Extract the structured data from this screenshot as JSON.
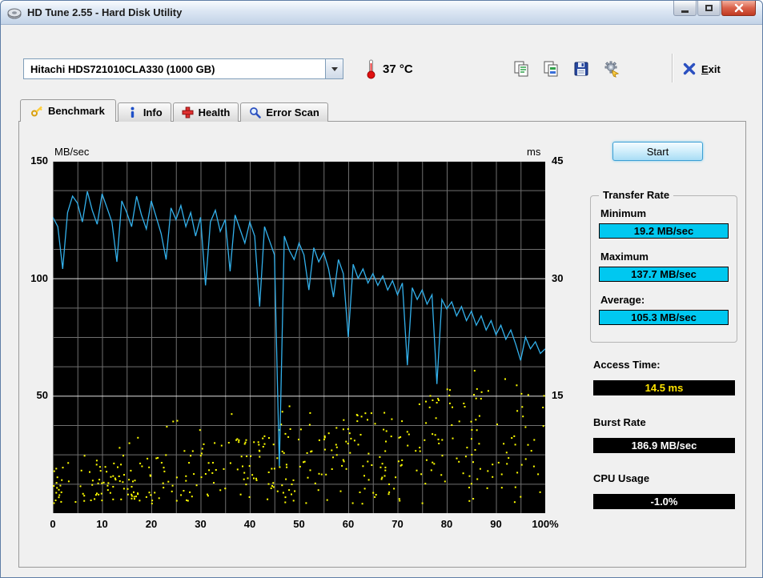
{
  "window": {
    "title": "HD Tune 2.55 - Hard Disk Utility"
  },
  "toolbar": {
    "device_select": {
      "value": "Hitachi HDS721010CLA330 (1000 GB)"
    },
    "temperature": "37 °C",
    "buttons": [
      {
        "label": "",
        "icon": "copy-screenshot-icon"
      },
      {
        "label": "",
        "icon": "copy-to-file-icon"
      },
      {
        "label": "",
        "icon": "save-icon"
      },
      {
        "label": "",
        "icon": "options-icon"
      }
    ],
    "exit": {
      "accesskey": "E",
      "rest": "xit"
    }
  },
  "tabs": [
    {
      "label": "Benchmark",
      "active": true
    },
    {
      "label": "Info",
      "active": false
    },
    {
      "label": "Health",
      "active": false
    },
    {
      "label": "Error Scan",
      "active": false
    }
  ],
  "chart_data": {
    "type": "line",
    "title": "HD Tune benchmark transfer rate and access time",
    "y_left_label": "MB/sec",
    "y_right_label": "ms",
    "y_left_range": [
      0,
      150
    ],
    "y_right_range": [
      0,
      45
    ],
    "x_range": [
      0,
      100
    ],
    "y_left_ticks": [
      150,
      100,
      50
    ],
    "y_right_ticks": [
      45,
      30,
      15
    ],
    "x_tick_labels": [
      "0",
      "10",
      "20",
      "30",
      "40",
      "50",
      "60",
      "70",
      "80",
      "90",
      "100%"
    ],
    "grid": {
      "x_step": 5,
      "y_step": 12.5,
      "major_y_step": 50,
      "minor_color": "#6f6f6f",
      "major_color": "#e2e2e2"
    },
    "line_color": "#33b1ec",
    "scatter_color": "#ffff00",
    "series": [
      {
        "name": "transfer_rate_mb_per_sec",
        "x_start": 0,
        "x_step": 1,
        "values": [
          126,
          122,
          104,
          128,
          135,
          132,
          124,
          137,
          129,
          123,
          136,
          130,
          124,
          107,
          133,
          128,
          122,
          135,
          127,
          121,
          133,
          126,
          119,
          108,
          130,
          125,
          131,
          122,
          128,
          118,
          126,
          97,
          124,
          129,
          120,
          125,
          103,
          127,
          121,
          115,
          124,
          118,
          88,
          122,
          116,
          110,
          20,
          118,
          112,
          108,
          115,
          110,
          95,
          113,
          107,
          111,
          104,
          92,
          108,
          102,
          75,
          106,
          100,
          104,
          98,
          102,
          97,
          101,
          95,
          99,
          93,
          98,
          63,
          96,
          91,
          95,
          89,
          93,
          55,
          91,
          87,
          90,
          84,
          88,
          82,
          86,
          80,
          84,
          78,
          82,
          76,
          80,
          74,
          78,
          72,
          65,
          75,
          70,
          73,
          68,
          70
        ]
      }
    ],
    "scatter": {
      "name": "access_time_ms",
      "count": 430,
      "seed": 11,
      "base_ms": 3.5,
      "slope_ms_per_pct": 0.13,
      "noise_ms": 4.5,
      "max_ms": 21
    }
  },
  "results": {
    "start_button": "Start",
    "transfer_rate": {
      "group_label": "Transfer Rate",
      "minimum_label": "Minimum",
      "minimum_value": "19.2 MB/sec",
      "maximum_label": "Maximum",
      "maximum_value": "137.7 MB/sec",
      "average_label": "Average:",
      "average_value": "105.3 MB/sec"
    },
    "access_time_label": "Access Time:",
    "access_time_value": "14.5 ms",
    "burst_rate_label": "Burst Rate",
    "burst_rate_value": "186.9 MB/sec",
    "cpu_usage_label": "CPU Usage",
    "cpu_usage_value": "-1.0%"
  },
  "colors": {
    "transfer_line": "#33b1ec",
    "access_dots": "#ffff00",
    "transfer_value_box": "#00c8f0",
    "access_value_text": "#ffe400",
    "plot_background": "#000000"
  }
}
